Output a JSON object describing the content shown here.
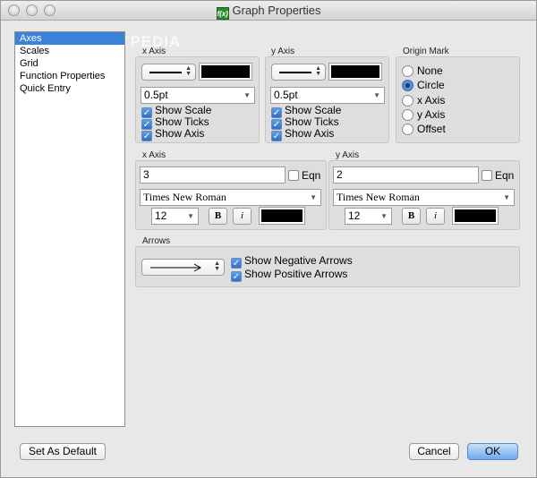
{
  "window": {
    "title": "Graph Properties",
    "app_icon_text": "f(x)"
  },
  "watermark": "SOFTPEDIA",
  "sidebar": {
    "items": [
      {
        "label": "Axes",
        "selected": true
      },
      {
        "label": "Scales",
        "selected": false
      },
      {
        "label": "Grid",
        "selected": false
      },
      {
        "label": "Function Properties",
        "selected": false
      },
      {
        "label": "Quick Entry",
        "selected": false
      }
    ]
  },
  "axes_style": {
    "x": {
      "label": "x Axis",
      "width": "0.5pt",
      "show_scale": "Show Scale",
      "show_ticks": "Show Ticks",
      "show_axis": "Show Axis"
    },
    "y": {
      "label": "y Axis",
      "width": "0.5pt",
      "show_scale": "Show Scale",
      "show_ticks": "Show Ticks",
      "show_axis": "Show Axis"
    },
    "line_color": "#000000"
  },
  "origin_mark": {
    "label": "Origin Mark",
    "options": [
      "None",
      "Circle",
      "x Axis",
      "y Axis",
      "Offset"
    ],
    "selected": "Circle"
  },
  "axis_labels": {
    "x": {
      "label": "x Axis",
      "value": "3",
      "eqn": "Eqn",
      "font": "Times New Roman",
      "size": "12",
      "bold": "B",
      "italic": "i"
    },
    "y": {
      "label": "y Axis",
      "value": "2",
      "eqn": "Eqn",
      "font": "Times New Roman",
      "size": "12",
      "bold": "B",
      "italic": "i"
    }
  },
  "arrows": {
    "label": "Arrows",
    "show_negative": "Show Negative Arrows",
    "show_positive": "Show Positive Arrows"
  },
  "buttons": {
    "set_default": "Set As Default",
    "cancel": "Cancel",
    "ok": "OK"
  },
  "colors": {
    "accent": "#3b82d8",
    "swatch": "#000000"
  }
}
